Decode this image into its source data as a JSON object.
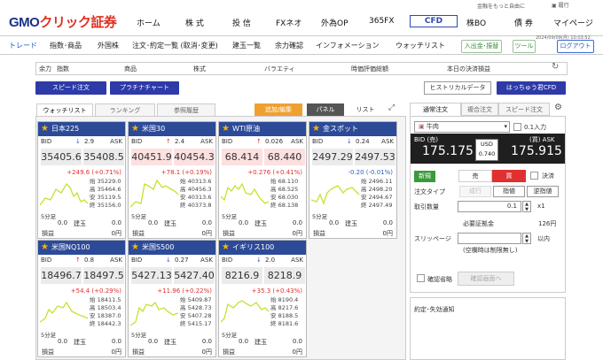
{
  "header": {
    "tagline": "金融をもっと自由に",
    "logout_top": "履行",
    "logo_main": "GMO",
    "logo_sub": "クリック証券",
    "nav": [
      "ホーム",
      "株 式",
      "投 信",
      "FXネオ",
      "外為OP",
      "365FX",
      "CFD",
      "株BO",
      "債 券",
      "マイページ"
    ],
    "active_nav": "CFD"
  },
  "subnav": {
    "items": [
      "トレード",
      "指数･商品",
      "外国株",
      "注文･約定一覧 (取消･変更)",
      "建玉一覧",
      "余力確認",
      "インフォメーション",
      "ウォッチリスト"
    ],
    "buttons": {
      "deposit": "入出金･振替",
      "tool": "ツール",
      "logout": "ログアウト"
    },
    "datetime": "2024/09/09(月) 10:03:52"
  },
  "inforow": {
    "items": [
      "余力",
      "指数",
      "商品",
      "株式",
      "バラエティ",
      "時価評価総額",
      "本日の決済損益"
    ]
  },
  "buttons": {
    "speed_order": "スピード注文",
    "platinum_chart": "プラチナチャート",
    "historical": "ヒストリカルデータ",
    "hacchu": "はっちゅう君CFD"
  },
  "left_tabs": {
    "watchlist": "ウォッチリスト",
    "ranking": "ランキング",
    "history": "参照履歴"
  },
  "view_controls": {
    "add_edit": "追加/編集",
    "panel": "パネル",
    "list": "リスト"
  },
  "labels": {
    "bid": "BID",
    "ask": "ASK",
    "min5": "5分足",
    "gyoku": "建玉",
    "sonneki": "損益",
    "zero": "0.0",
    "zero_yen": "0円",
    "hi": "始",
    "ta": "高",
    "yasu": "安",
    "owa": "終"
  },
  "cards": [
    {
      "name": "日本225",
      "dir": "down",
      "spread": "2.9",
      "bid": "35405.6",
      "ask": "35408.5",
      "change": "+249.6 (+0.71%)",
      "chg_dir": "up",
      "ohlc": [
        "35229.0",
        "35464.6",
        "35119.5",
        "35156.0"
      ],
      "hi_bid": false,
      "hi_ask": false
    },
    {
      "name": "米国30",
      "dir": "up",
      "spread": "2.4",
      "bid": "40451.9",
      "ask": "40454.3",
      "change": "+78.1 (+0.19%)",
      "chg_dir": "up",
      "ohlc": [
        "40313.6",
        "40456.3",
        "40313.6",
        "40373.8"
      ],
      "hi_bid": true,
      "hi_ask": true
    },
    {
      "name": "WTI原油",
      "dir": "up",
      "spread": "0.026",
      "bid": "68.414",
      "ask": "68.440",
      "change": "+0.276 (+0.41%)",
      "chg_dir": "up",
      "ohlc": [
        "68.110",
        "68.525",
        "68.030",
        "68.138"
      ],
      "hi_bid": true,
      "hi_ask": true
    },
    {
      "name": "金スポット",
      "dir": "down",
      "spread": "0.24",
      "bid": "2497.29",
      "ask": "2497.53",
      "change": "-0.20 (-0.01%)",
      "chg_dir": "down",
      "ohlc": [
        "2496.11",
        "2498.20",
        "2494.67",
        "2497.49"
      ],
      "hi_bid": false,
      "hi_ask": false
    },
    {
      "name": "米国NQ100",
      "dir": "up",
      "spread": "0.8",
      "bid": "18496.7",
      "ask": "18497.5",
      "change": "+54.4 (+0.29%)",
      "chg_dir": "up",
      "ohlc": [
        "18411.5",
        "18503.4",
        "18387.0",
        "18442.3"
      ],
      "hi_bid": false,
      "hi_ask": false
    },
    {
      "name": "米国S500",
      "dir": "down",
      "spread": "0.27",
      "bid": "5427.13",
      "ask": "5427.40",
      "change": "+11.96 (+0.22%)",
      "chg_dir": "up",
      "ohlc": [
        "5409.87",
        "5428.73",
        "5407.28",
        "5415.17"
      ],
      "hi_bid": false,
      "hi_ask": false
    },
    {
      "name": "イギリス100",
      "dir": "down",
      "spread": "2.0",
      "bid": "8216.9",
      "ask": "8218.9",
      "change": "+35.3 (+0.43%)",
      "chg_dir": "up",
      "ohlc": [
        "8190.4",
        "8217.6",
        "8188.5",
        "8181.6"
      ],
      "hi_bid": false,
      "hi_ask": false
    }
  ],
  "order": {
    "tabs": [
      "通常注文",
      "複合注文",
      "スピード注文"
    ],
    "product": "牛肉",
    "unit_input": "0.1入力",
    "bid_label": "BID (売)",
    "ask_label": "(買) ASK",
    "bid_price": "175.175",
    "ask_price": "175.915",
    "currency": "USD",
    "spread": "0.740",
    "new_label": "新規",
    "sell": "売",
    "buy": "買",
    "settle": "決済",
    "order_type_label": "注文タイプ",
    "types": [
      "成行",
      "指値",
      "逆指値"
    ],
    "qty_label": "取引数量",
    "qty_value": "0.1",
    "qty_mult": "x1",
    "margin_label": "必要証拠金",
    "margin_value": "126円",
    "slippage_label": "スリッページ",
    "slippage_unit": "以内",
    "slippage_note": "(空欄時は制限無し)",
    "confirm_skip": "確認省略",
    "confirm_btn": "確認画面へ",
    "notify_title": "約定･失効通知"
  },
  "colors": {
    "navy": "#2e3aa8",
    "card_header": "#2d4a98",
    "orange": "#f0a030",
    "red": "#e03030",
    "blue": "#3060c0"
  }
}
